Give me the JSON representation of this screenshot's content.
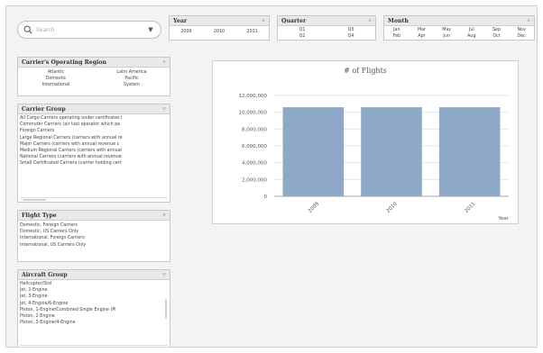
{
  "search": {
    "placeholder": "Search"
  },
  "year": {
    "title": "Year",
    "values": [
      "2009",
      "2010",
      "2011"
    ]
  },
  "quarter": {
    "title": "Quarter",
    "values": [
      "Q1",
      "Q3",
      "Q2",
      "Q4"
    ]
  },
  "month": {
    "title": "Month",
    "values": [
      "Jan",
      "Mar",
      "May",
      "Jul",
      "Sep",
      "Nov",
      "Feb",
      "Apr",
      "Jun",
      "Aug",
      "Oct",
      "Dec"
    ]
  },
  "region": {
    "title": "Carrier's Operating Region",
    "values": [
      "Atlantic",
      "Latin America",
      "Domestic",
      "Pacific",
      "International",
      "System"
    ]
  },
  "carrier_group": {
    "title": "Carrier Group",
    "items": [
      "All Cargo Carriers operating under certificates i",
      "Commuter Carriers (air taxi operator which pe",
      "Foreign Carriers",
      "Large Regional Carriers (carriers with annual re",
      "Major Carriers (carriers with annual revenue c",
      "Medium Regional Carriers (carriers with annual",
      "National Carriers (carriers with annual revenue",
      "Small Certificated Carriers (carrier holding cert"
    ]
  },
  "flight_type": {
    "title": "Flight Type",
    "items": [
      "Domestic, Foreign Carriers",
      "Domestic, US Carriers Only",
      "International, Foreign Carriers",
      "International, US Carriers Only"
    ]
  },
  "aircraft_group": {
    "title": "Aircraft Group",
    "items": [
      "Helicopter/Stol",
      "Jet, 2-Engine",
      "Jet, 3-Engine",
      "Jet, 4-Engine/6-Engine",
      "Piston, 1-Engine/Combined Single Engine (Pi",
      "Piston, 2-Engine",
      "Piston, 3-Engine/4-Engine"
    ]
  },
  "chart_data": {
    "type": "bar",
    "title": "# of Flights",
    "xlabel": "Year",
    "ylabel": "",
    "categories": [
      "2009",
      "2010",
      "2011"
    ],
    "values": [
      10600000,
      10600000,
      10600000
    ],
    "ylim": [
      0,
      12000000
    ],
    "yticks": [
      "12,000,000",
      "10,000,000",
      "8,000,000",
      "6,000,000",
      "4,000,000",
      "2,000,000",
      "0"
    ],
    "bar_color": "#8ea9c8",
    "grid": true
  }
}
